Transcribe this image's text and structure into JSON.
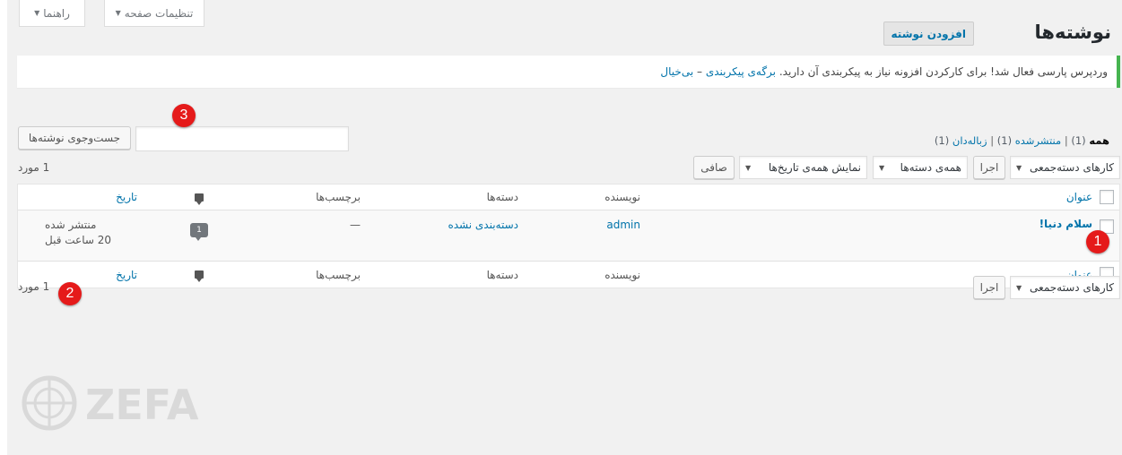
{
  "screen_meta": {
    "screen_options": "تنظیمات صفحه",
    "help": "راهنما"
  },
  "header": {
    "title": "نوشته‌ها",
    "add_new": "افزودن نوشته"
  },
  "notice": {
    "text": "وردپرس پارسی فعال شد! برای کارکردن افزونه نیاز به پیکربندی آن دارید.",
    "link1": "برگه‌ی پیکربندی",
    "sep": "–",
    "link2": "بی‌خیال"
  },
  "views": {
    "all": "همه",
    "all_count": "(1)",
    "published": "منتشرشده",
    "published_count": "(1)",
    "trash": "زباله‌دان",
    "trash_count": "(1)",
    "divider": "|"
  },
  "search": {
    "button": "جست‌وجوی نوشته‌ها",
    "value": ""
  },
  "tablenav_top": {
    "bulk_actions": "کارهای دسته‌جمعی",
    "apply": "اجرا",
    "all_categories": "همه‌ی دسته‌ها",
    "all_dates": "نمایش همه‌ی تاریخ‌ها",
    "filter": "صافی",
    "count": "1 مورد"
  },
  "table": {
    "headers": {
      "title": "عنوان",
      "author": "نویسنده",
      "categories": "دسته‌ها",
      "tags": "برچسب‌ها",
      "comments_icon": "comment-icon",
      "date": "تاریخ"
    },
    "rows": [
      {
        "title": "سلام دنیا!",
        "author": "admin",
        "categories": "دسته‌بندی نشده",
        "tags": "—",
        "comments": "1",
        "status": "منتشر شده",
        "date": "20 ساعت قبل"
      }
    ]
  },
  "tablenav_bottom": {
    "bulk_actions": "کارهای دسته‌جمعی",
    "apply": "اجرا",
    "count": "1 مورد"
  },
  "markers": {
    "m1": "1",
    "m2": "2",
    "m3": "3"
  },
  "watermark": {
    "text": "ZEFA"
  },
  "colors": {
    "link": "#0073aa",
    "marker": "#e51a1a",
    "notice_border": "#46b450"
  }
}
